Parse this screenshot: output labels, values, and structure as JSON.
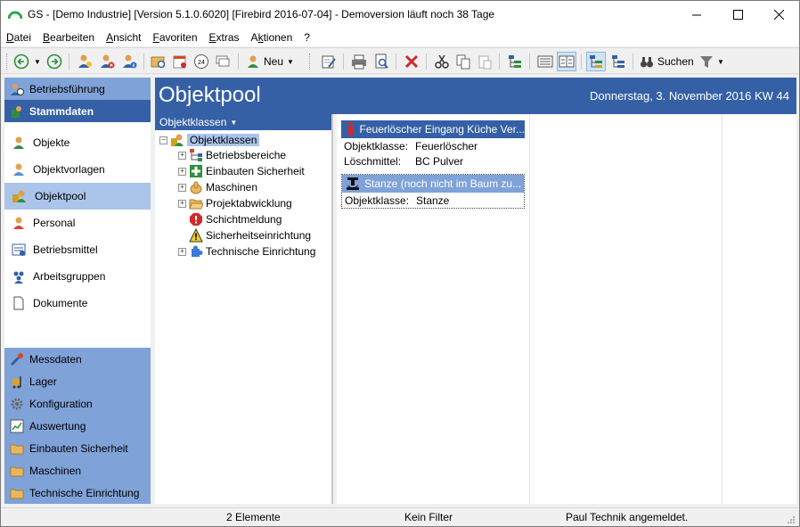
{
  "window": {
    "title": "GS - [Demo Industrie]  [Version  5.1.0.6020]  [Firebird 2016-07-04] - Demoversion läuft noch 38 Tage",
    "minimize": "—",
    "maximize": "☐",
    "close": "✕"
  },
  "menu": [
    {
      "label": "Datei",
      "accel": "D",
      "rest": "atei"
    },
    {
      "label": "Bearbeiten",
      "accel": "B",
      "rest": "earbeiten"
    },
    {
      "label": "Ansicht",
      "accel": "A",
      "rest": "nsicht"
    },
    {
      "label": "Favoriten",
      "accel": "F",
      "rest": "avoriten"
    },
    {
      "label": "Extras",
      "accel": "E",
      "rest": "xtras"
    },
    {
      "label": "Aktionen",
      "accel": "k",
      "pre": "A",
      "rest": "tionen"
    },
    {
      "label": "?",
      "accel": "",
      "rest": "?"
    }
  ],
  "toolbar": {
    "new_label": "Neu",
    "search_label": "Suchen",
    "icons": [
      "back-icon",
      "forward-icon",
      "user-add-icon",
      "user-delete-icon",
      "user-info-icon",
      "folder-search-icon",
      "calendar-icon",
      "clock-24-icon",
      "comment-icon",
      "new-icon",
      "edit-icon",
      "print-icon",
      "print-preview-icon",
      "delete-icon",
      "cut-icon",
      "copy-icon",
      "paste-icon",
      "tree-export-icon",
      "list-view-icon",
      "detail-view-icon",
      "tree-view-icon",
      "tree-csv-icon",
      "binoculars-icon",
      "filter-icon"
    ]
  },
  "sidebar": {
    "top_groups": [
      {
        "label": "Betriebsführung",
        "icon": "clock-person-icon"
      },
      {
        "label": "Stammdaten",
        "icon": "database-icon"
      }
    ],
    "items": [
      {
        "label": "Objekte",
        "icon": "object-icon",
        "selected": false
      },
      {
        "label": "Objektvorlagen",
        "icon": "object-template-icon",
        "selected": false
      },
      {
        "label": "Objektpool",
        "icon": "object-pool-icon",
        "selected": true
      },
      {
        "label": "Personal",
        "icon": "person-icon",
        "selected": false
      },
      {
        "label": "Betriebsmittel",
        "icon": "equipment-icon",
        "selected": false
      },
      {
        "label": "Arbeitsgruppen",
        "icon": "group-icon",
        "selected": false
      },
      {
        "label": "Dokumente",
        "icon": "document-icon",
        "selected": false
      }
    ],
    "bottom_groups": [
      {
        "label": "Messdaten",
        "icon": "probe-icon"
      },
      {
        "label": "Lager",
        "icon": "forklift-icon"
      },
      {
        "label": "Konfiguration",
        "icon": "gear-icon"
      },
      {
        "label": "Auswertung",
        "icon": "chart-icon"
      },
      {
        "label": "Einbauten Sicherheit",
        "icon": "folder-icon"
      },
      {
        "label": "Maschinen",
        "icon": "folder-icon"
      },
      {
        "label": "Technische Einrichtung",
        "icon": "folder-icon"
      }
    ]
  },
  "main": {
    "title": "Objektpool",
    "date": "Donnerstag, 3. November 2016  KW 44"
  },
  "tree": {
    "header": "Objektklassen",
    "root": "Objektklassen",
    "nodes": [
      {
        "label": "Betriebsbereiche",
        "icon": "network-icon",
        "expandable": true
      },
      {
        "label": "Einbauten Sicherheit",
        "icon": "first-aid-icon",
        "expandable": true
      },
      {
        "label": "Maschinen",
        "icon": "hand-icon",
        "expandable": true
      },
      {
        "label": "Projektabwicklung",
        "icon": "folder-open-icon",
        "expandable": true
      },
      {
        "label": "Schichtmeldung",
        "icon": "alert-red-icon",
        "expandable": false
      },
      {
        "label": "Sicherheitseinrichtung",
        "icon": "warning-icon",
        "expandable": false
      },
      {
        "label": "Technische Einrichtung",
        "icon": "puzzle-icon",
        "expandable": true
      }
    ]
  },
  "cards": [
    {
      "title": "Feuerlöscher Eingang Küche Ver...",
      "icon": "extinguisher-icon",
      "rows": [
        {
          "key": "Objektklasse:",
          "value": "Feuerlöscher"
        },
        {
          "key": "Löschmittel:",
          "value": "BC Pulver"
        }
      ]
    },
    {
      "title": "Stanze (noch nicht im Baum zu...",
      "icon": "press-machine-icon",
      "rows": [
        {
          "key": "Objektklasse:",
          "value": "Stanze"
        }
      ]
    }
  ],
  "status": {
    "count": "2 Elemente",
    "filter": "Kein Filter",
    "user": "Paul Technik angemeldet."
  }
}
